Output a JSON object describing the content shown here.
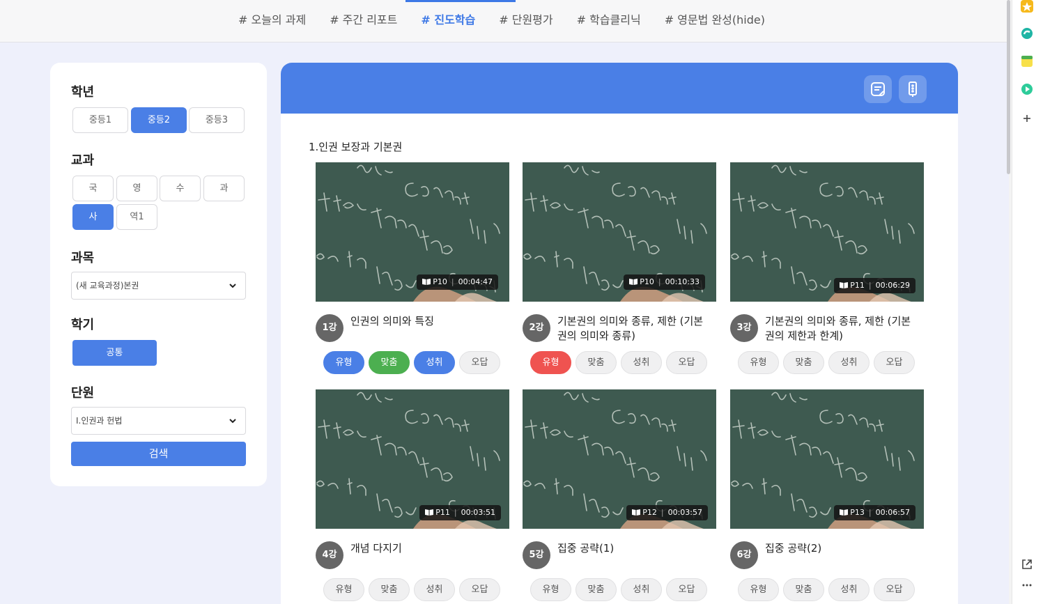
{
  "topnav": {
    "tabs": [
      "# 오늘의 과제",
      "# 주간 리포트",
      "# 진도학습",
      "# 단원평가",
      "# 학습클리닉",
      "# 영문법 완성(hide)"
    ],
    "active_index": 2
  },
  "sidebar": {
    "grade": {
      "title": "학년",
      "options": [
        "중등1",
        "중등2",
        "중등3"
      ],
      "selected": "중등2"
    },
    "course": {
      "title": "교과",
      "options": [
        "국",
        "영",
        "수",
        "과",
        "사",
        "역1"
      ],
      "selected": "사"
    },
    "subject": {
      "title": "과목",
      "value": "(새 교육과정)본권"
    },
    "semester": {
      "title": "학기",
      "button": "공통"
    },
    "unit": {
      "title": "단원",
      "value": "Ⅰ.인권과 헌법"
    },
    "search_label": "검색"
  },
  "main": {
    "header_icons": [
      "note-icon",
      "traffic-light-icon"
    ],
    "unit_title": "1.인권 보장과 기본권",
    "lessons": [
      {
        "num": "1강",
        "title": "인권의 의미와 특징",
        "page": "P10",
        "time": "00:04:47",
        "selected": true,
        "chips": [
          {
            "label": "유형",
            "state": "blue"
          },
          {
            "label": "맞춤",
            "state": "green"
          },
          {
            "label": "성취",
            "state": "blue"
          },
          {
            "label": "오답",
            "state": "none"
          }
        ]
      },
      {
        "num": "2강",
        "title": "기본권의 의미와 종류, 제한 (기본권의 의미와 종류)",
        "page": "P10",
        "time": "00:10:33",
        "selected": true,
        "chips": [
          {
            "label": "유형",
            "state": "red"
          },
          {
            "label": "맞춤",
            "state": "none"
          },
          {
            "label": "성취",
            "state": "none"
          },
          {
            "label": "오답",
            "state": "none"
          }
        ]
      },
      {
        "num": "3강",
        "title": "기본권의 의미와 종류, 제한 (기본권의 제한과 한계)",
        "page": "P11",
        "time": "00:06:29",
        "selected": false,
        "chips": [
          {
            "label": "유형",
            "state": "none"
          },
          {
            "label": "맞춤",
            "state": "none"
          },
          {
            "label": "성취",
            "state": "none"
          },
          {
            "label": "오답",
            "state": "none"
          }
        ]
      },
      {
        "num": "4강",
        "title": "개념 다지기",
        "page": "P11",
        "time": "00:03:51",
        "selected": false,
        "chips": [
          {
            "label": "유형",
            "state": "none"
          },
          {
            "label": "맞춤",
            "state": "none"
          },
          {
            "label": "성취",
            "state": "none"
          },
          {
            "label": "오답",
            "state": "none"
          }
        ]
      },
      {
        "num": "5강",
        "title": "집중 공략(1)",
        "page": "P12",
        "time": "00:03:57",
        "selected": false,
        "chips": [
          {
            "label": "유형",
            "state": "none"
          },
          {
            "label": "맞춤",
            "state": "none"
          },
          {
            "label": "성취",
            "state": "none"
          },
          {
            "label": "오답",
            "state": "none"
          }
        ]
      },
      {
        "num": "6강",
        "title": "집중 공략(2)",
        "page": "P13",
        "time": "00:06:57",
        "selected": false,
        "chips": [
          {
            "label": "유형",
            "state": "none"
          },
          {
            "label": "맞춤",
            "state": "none"
          },
          {
            "label": "성취",
            "state": "none"
          },
          {
            "label": "오답",
            "state": "none"
          }
        ]
      }
    ]
  },
  "colors": {
    "accent": "#4a7fe6",
    "green": "#4caf50",
    "red": "#ef5350",
    "selected_border": "#e05a5a"
  },
  "edgebar_icons": [
    "favorites-icon",
    "edge-icon",
    "notes-icon",
    "media-icon",
    "add-icon",
    "open-external-icon",
    "more-icon"
  ]
}
